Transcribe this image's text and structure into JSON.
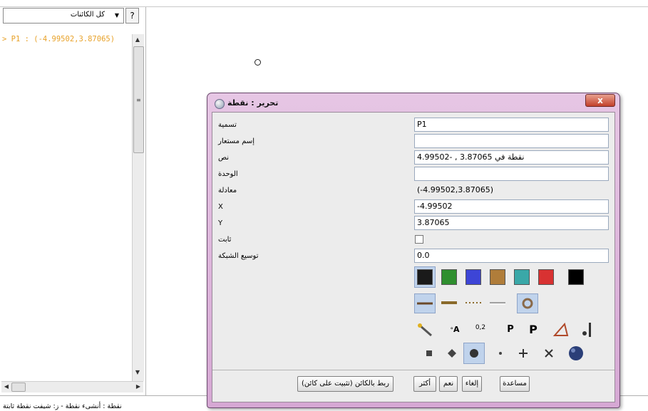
{
  "sidebar": {
    "help_label": "?",
    "filter_value": "كل الكائنات",
    "object_lines": [
      "> P1 : (-4.99502,3.87065)"
    ]
  },
  "status": {
    "text": "نقطة : أنشىء نقطة - ز: شيفت نقطة ثابتة"
  },
  "dialog": {
    "title": "تحرير : نقطة",
    "close_label": "x",
    "rows": {
      "name": {
        "label": "تسمية",
        "value": "P1"
      },
      "alias": {
        "label": "إسم مستعار",
        "value": ""
      },
      "text": {
        "label": "نص",
        "value": "نقطة في 3.87065 , -4.99502"
      },
      "unit": {
        "label": "الوحدة",
        "value": ""
      },
      "equation": {
        "label": "معادلة",
        "value": "(-4.99502,3.87065)"
      },
      "x": {
        "label": "X",
        "value": "-4.99502"
      },
      "y": {
        "label": "Y",
        "value": "3.87065"
      },
      "fixed": {
        "label": "ثابت",
        "checked": false
      },
      "grid": {
        "label": "توسيع الشبكة",
        "value": "0.0"
      }
    },
    "colors": [
      "#1a1a1a",
      "#2f8f2f",
      "#3d45d6",
      "#b07d3a",
      "#3aa8a8",
      "#d83232",
      "#000000"
    ],
    "line_styles": [
      "solid-line-icon",
      "thick-line-icon",
      "dotted-line-icon",
      "thin-line-icon",
      "ring-icon"
    ],
    "tools": {
      "t1": "magic-wand-icon",
      "t2": "A",
      "t3": "0,2",
      "t4": "P",
      "t5": "P",
      "t6": "triangle-icon",
      "t7": "point-marker-icon"
    },
    "shapes": [
      "square-icon",
      "diamond-icon",
      "sphere-icon",
      "dot-icon",
      "plus-icon",
      "cross-icon",
      "big-sphere-icon"
    ],
    "buttons": {
      "link": "(ربط بالكائن   (تثبيت على كائن",
      "more": "أكثر",
      "yes": "نعم",
      "cancel": "إلغاء",
      "help": "مساعدة"
    }
  }
}
